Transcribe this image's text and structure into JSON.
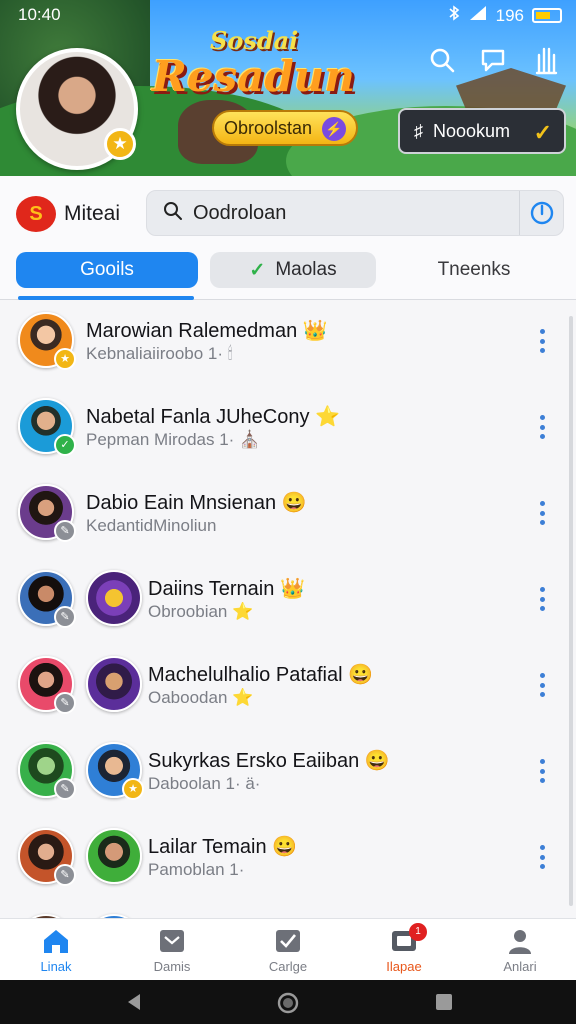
{
  "status_bar": {
    "time": "10:40",
    "signal": "196"
  },
  "header": {
    "title_line1": "Sosdai",
    "title_line2": "Resadun",
    "yellow_pill_label": "Obroolstan",
    "dark_pill_label": "Noookum"
  },
  "brand": {
    "name": "Miteai"
  },
  "search": {
    "value": "Oodroloan"
  },
  "tabs": [
    {
      "label": "Gooils"
    },
    {
      "label": "Maolas"
    },
    {
      "label": "Tneenks"
    }
  ],
  "contacts": [
    {
      "name": "Marowian Ralemedman",
      "sub": "Kebnaliaiiroobo 1·",
      "emoji": "👑",
      "sub_icon": "🕯",
      "badge_color": "#f2b615"
    },
    {
      "name": "Nabetal Fanla JUheCony",
      "sub": "Pepman Mirodas 1·",
      "emoji": "⭐",
      "sub_icon": "⛪",
      "badge_color": "#2fb24a"
    },
    {
      "name": "Dabio Eain Mnsienan",
      "sub": "KedantidMinoliun",
      "emoji": "😀",
      "sub_icon": "",
      "badge_color": "#8c8f96"
    },
    {
      "name": "Daiins Ternain",
      "sub": "Obroobian",
      "emoji": "👑",
      "sub_icon": "⭐",
      "badge_color": "#8c8f96"
    },
    {
      "name": "Machelulhalio Patafial",
      "sub": "Oaboodan",
      "emoji": "😀",
      "sub_icon": "⭐",
      "badge_color": "#8c8f96"
    },
    {
      "name": "Sukyrkas Ersko Eaiiban",
      "sub": "Daboolan 1· ä·",
      "emoji": "😀",
      "sub_icon": "",
      "badge_color": "#8c8f96"
    },
    {
      "name": "Lailar Temain",
      "sub": "Pamoblan 1·",
      "emoji": "😀",
      "sub_icon": "",
      "badge_color": "#8c8f96"
    }
  ],
  "bottom_nav": [
    {
      "label": "Linak"
    },
    {
      "label": "Damis"
    },
    {
      "label": "Carlge"
    },
    {
      "label": "Ilapae"
    },
    {
      "label": "Anlari"
    }
  ],
  "colors": {
    "accent": "#1f86f0",
    "alert": "#e8571b",
    "badge_red": "#e02020"
  }
}
